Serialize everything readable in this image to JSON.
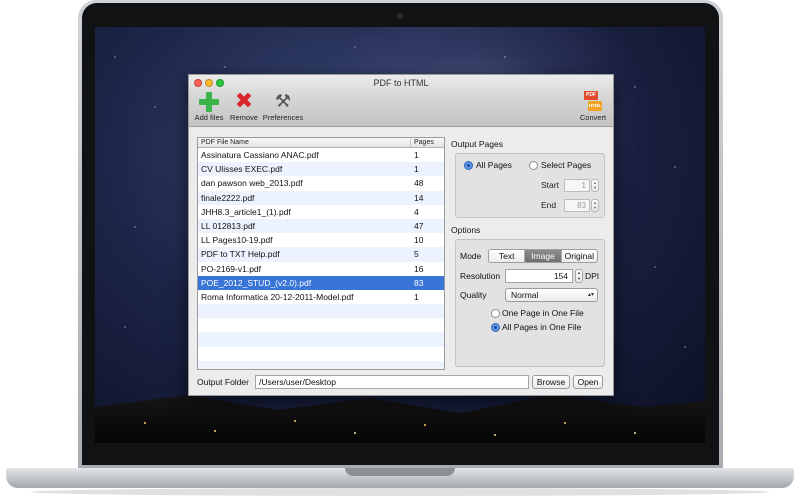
{
  "window": {
    "title": "PDF to HTML"
  },
  "toolbar": {
    "add_label": "Add files",
    "remove_label": "Remove",
    "preferences_label": "Preferences",
    "convert_label": "Convert",
    "convert_icon_top": "PDF",
    "convert_icon_bottom": "HTML"
  },
  "file_table": {
    "headers": {
      "name": "PDF File Name",
      "pages": "Pages"
    },
    "rows": [
      {
        "name": "Assinatura Cassiano ANAC.pdf",
        "pages": "1"
      },
      {
        "name": "CV Ulisses EXEC.pdf",
        "pages": "1"
      },
      {
        "name": "dan pawson web_2013.pdf",
        "pages": "48"
      },
      {
        "name": "finale2222.pdf",
        "pages": "14"
      },
      {
        "name": "JHH8.3_article1_(1).pdf",
        "pages": "4"
      },
      {
        "name": "LL 012813.pdf",
        "pages": "47"
      },
      {
        "name": "LL Pages10-19.pdf",
        "pages": "10"
      },
      {
        "name": "PDF to TXT Help.pdf",
        "pages": "5"
      },
      {
        "name": "PO-2169-v1.pdf",
        "pages": "16"
      },
      {
        "name": "POE_2012_STUD_(v2.0).pdf",
        "pages": "83",
        "selected": true
      },
      {
        "name": "Roma Informatica 20-12-2011-Model.pdf",
        "pages": "1"
      }
    ]
  },
  "output_pages": {
    "title": "Output Pages",
    "all_pages_label": "All Pages",
    "select_pages_label": "Select Pages",
    "start_label": "Start",
    "start_value": "1",
    "end_label": "End",
    "end_value": "83",
    "selected": "All Pages"
  },
  "options": {
    "title": "Options",
    "mode_label": "Mode",
    "modes": [
      "Text",
      "Image",
      "Original"
    ],
    "active_mode": "Image",
    "resolution_label": "Resolution",
    "resolution_value": "154",
    "resolution_unit": "DPI",
    "quality_label": "Quality",
    "quality_value": "Normal",
    "one_page_label": "One Page in One File",
    "all_pages_file_label": "All Pages in One File",
    "selected_output": "All Pages in One File"
  },
  "output_folder": {
    "label": "Output Folder",
    "path": "/Users/user/Desktop",
    "browse_label": "Browse",
    "open_label": "Open"
  },
  "colors": {
    "selection": "#3875d7",
    "add_icon": "#39b54a",
    "remove_icon": "#d9262c"
  },
  "icons": {
    "add": "plus-icon",
    "remove": "x-icon",
    "preferences": "tools-icon",
    "convert": "pdf-to-html-icon"
  }
}
